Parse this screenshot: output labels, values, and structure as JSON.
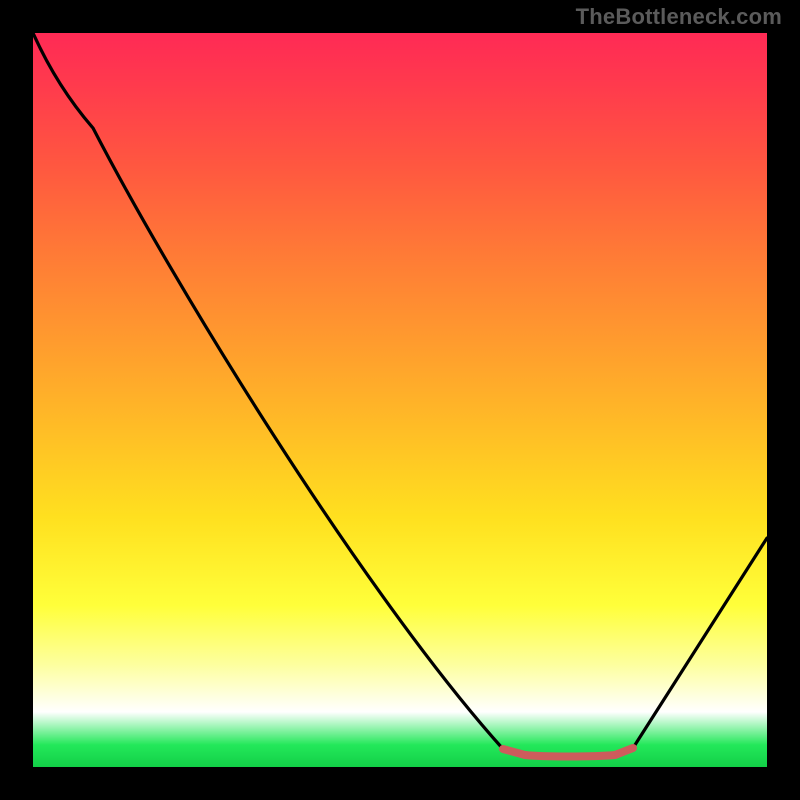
{
  "watermark": "TheBottleneck.com",
  "colors": {
    "frame": "#000000",
    "curve": "#000000",
    "highlight": "#cd5c5c",
    "gradient_top": "#ff2a55",
    "gradient_mid": "#ffe01f",
    "gradient_bottom": "#12cf47"
  },
  "chart_data": {
    "type": "line",
    "title": "",
    "xlabel": "",
    "ylabel": "",
    "x_range_normalized": [
      0,
      100
    ],
    "y_range_normalized": [
      0,
      100
    ],
    "note": "Axes have no visible tick labels; values are normalized 0–100 from pixel positions. y = 0 is the bottom (optimal / green), y = 100 is the top (worst / red).",
    "series": [
      {
        "name": "bottleneck-curve",
        "color": "#000000",
        "x": [
          0,
          3,
          8,
          15,
          25,
          35,
          45,
          55,
          63,
          67,
          73,
          79,
          82,
          88,
          94,
          100
        ],
        "y": [
          100,
          95,
          88,
          80,
          65,
          50,
          36,
          22,
          10,
          2,
          1,
          1,
          2,
          10,
          20,
          31
        ]
      },
      {
        "name": "optimal-region-highlight",
        "color": "#cd5c5c",
        "x": [
          64,
          67,
          73,
          79,
          82
        ],
        "y": [
          2,
          1,
          1,
          1,
          2
        ]
      }
    ],
    "background_gradient": {
      "orientation": "vertical",
      "stops": [
        {
          "pos": 0.0,
          "color": "#ff2a55"
        },
        {
          "pos": 0.3,
          "color": "#ff7a36"
        },
        {
          "pos": 0.6,
          "color": "#ffe01f"
        },
        {
          "pos": 0.85,
          "color": "#fdff9e"
        },
        {
          "pos": 0.925,
          "color": "#ffffff"
        },
        {
          "pos": 1.0,
          "color": "#12cf47"
        }
      ]
    }
  }
}
